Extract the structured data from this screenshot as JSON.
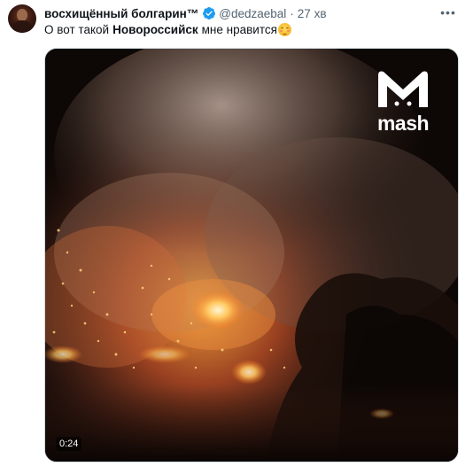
{
  "tweet": {
    "display_name": "восхищённый болгарин™",
    "handle": "@dedzaebal",
    "separator": "·",
    "time": "27 хв",
    "more_label": "•••",
    "text_before": "О вот такой",
    "text_bold": "Новороссийск",
    "text_after": "мне нравится",
    "emoji": "smiling-face-with-blush-emoji"
  },
  "media": {
    "watermark_text": "mash",
    "duration": "0:24",
    "icon": "video-thumbnail"
  },
  "colors": {
    "verified_blue": "#1d9bf0",
    "text_primary": "#0f1419",
    "text_secondary": "#536471",
    "border": "#cfd9de"
  }
}
